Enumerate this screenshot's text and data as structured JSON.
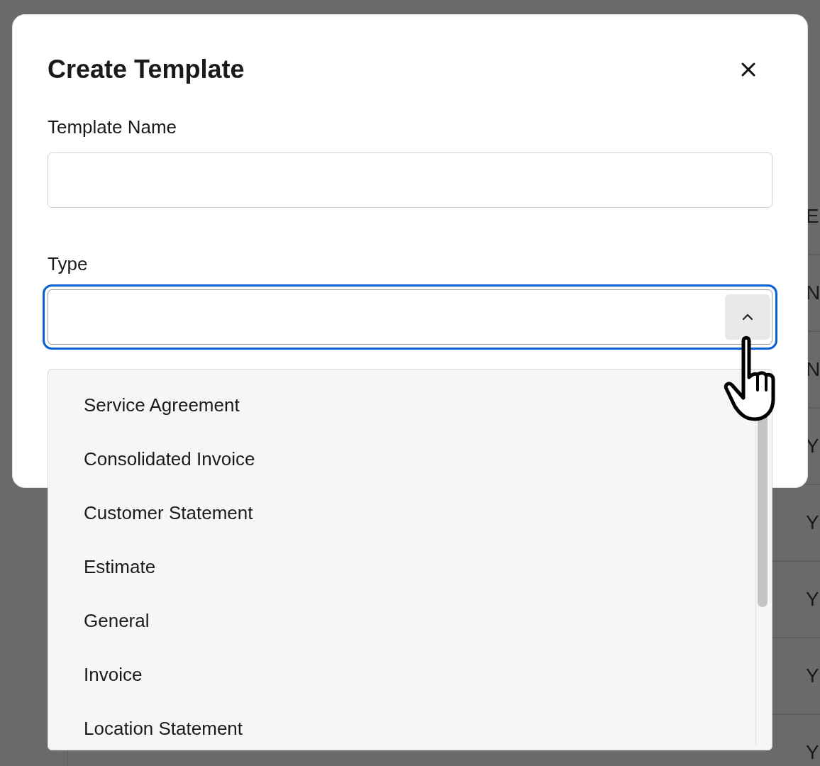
{
  "background": {
    "table": {
      "rows": [
        {
          "column_3": "E"
        },
        {
          "column_3": "N"
        },
        {
          "column_3": "N"
        },
        {
          "column_3": "Y"
        },
        {
          "column_3": "Y"
        },
        {
          "column_3": "Y"
        },
        {
          "column_3": "Y"
        },
        {
          "column_3": "Y"
        }
      ]
    }
  },
  "dialog": {
    "title": "Create Template",
    "fields": [
      {
        "kind": "text",
        "label": "Template Name",
        "focused": false
      },
      {
        "kind": "select",
        "label": "Type",
        "focused": true,
        "expanded": true
      }
    ],
    "dropdown": {
      "options": [
        {
          "label": "Service Agreement",
          "selected": false
        },
        {
          "label": "Consolidated Invoice",
          "selected": false
        },
        {
          "label": "Customer Statement",
          "selected": false
        },
        {
          "label": "Estimate",
          "selected": false
        },
        {
          "label": "General",
          "selected": false
        },
        {
          "label": "Invoice",
          "selected": false
        },
        {
          "label": "Location Statement",
          "selected": false
        }
      ]
    }
  }
}
